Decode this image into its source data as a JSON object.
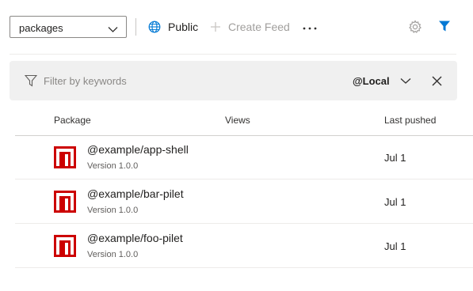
{
  "toolbar": {
    "feed_value": "packages",
    "public_label": "Public",
    "create_feed_label": "Create Feed"
  },
  "filter": {
    "placeholder": "Filter by keywords",
    "view_label": "@Local"
  },
  "table": {
    "columns": [
      "Package",
      "Views",
      "Last pushed"
    ],
    "rows": [
      {
        "name": "@example/app-shell",
        "version": "Version 1.0.0",
        "views": "",
        "pushed": "Jul 1"
      },
      {
        "name": "@example/bar-pilet",
        "version": "Version 1.0.0",
        "views": "",
        "pushed": "Jul 1"
      },
      {
        "name": "@example/foo-pilet",
        "version": "Version 1.0.0",
        "views": "",
        "pushed": "Jul 1"
      }
    ]
  },
  "icons": [
    "chevron-down-icon",
    "globe-icon",
    "plus-icon",
    "more-icon",
    "gear-icon",
    "filter-icon",
    "npm-logo-icon",
    "close-icon"
  ],
  "colors": {
    "accent": "#0078d4",
    "npm_red": "#cc0000",
    "filterbar_bg": "#f0f0f0",
    "disabled_text": "#a19f9d"
  }
}
